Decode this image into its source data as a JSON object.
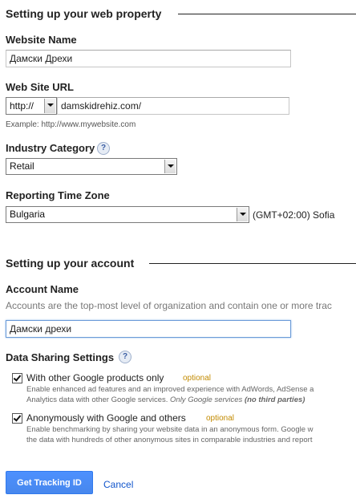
{
  "property_section": {
    "title": "Setting up your web property",
    "website_name_label": "Website Name",
    "website_name_value": "Дамски Дрехи",
    "url_label": "Web Site URL",
    "protocol_value": "http://",
    "url_value": "damskidrehiz.com/",
    "url_example": "Example: http://www.mywebsite.com",
    "industry_label": "Industry Category",
    "industry_value": "Retail",
    "timezone_label": "Reporting Time Zone",
    "timezone_country": "Bulgaria",
    "timezone_offset": "(GMT+02:00) Sofia"
  },
  "account_section": {
    "title": "Setting up your account",
    "account_name_label": "Account Name",
    "account_name_desc": "Accounts are the top-most level of organization and contain one or more trac",
    "account_name_value": "Дамски дрехи",
    "sharing_label": "Data Sharing Settings",
    "options": [
      {
        "label": "With other Google products only",
        "optional": "optional",
        "checked": true,
        "desc_line1": "Enable enhanced ad features and an improved experience with AdWords, AdSense a",
        "desc_line2_prefix": "Analytics data with other Google services. ",
        "desc_line2_em": "Only Google services ",
        "desc_line2_strong": "(no third parties)"
      },
      {
        "label": "Anonymously with Google and others",
        "optional": "optional",
        "checked": true,
        "desc_line1": "Enable benchmarking by sharing your website data in an anonymous form. Google w",
        "desc_line2": "the data with hundreds of other anonymous sites in comparable industries and report"
      }
    ]
  },
  "actions": {
    "primary_label": "Get Tracking ID",
    "cancel_label": "Cancel"
  },
  "colors": {
    "primary_button": "#4d90fe",
    "link": "#1155cc",
    "optional_tag": "#c28a00"
  },
  "icons": {
    "help": "help-icon",
    "dropdown": "chevron-down-icon",
    "check": "checkmark-icon"
  },
  "help_glyph": "?"
}
